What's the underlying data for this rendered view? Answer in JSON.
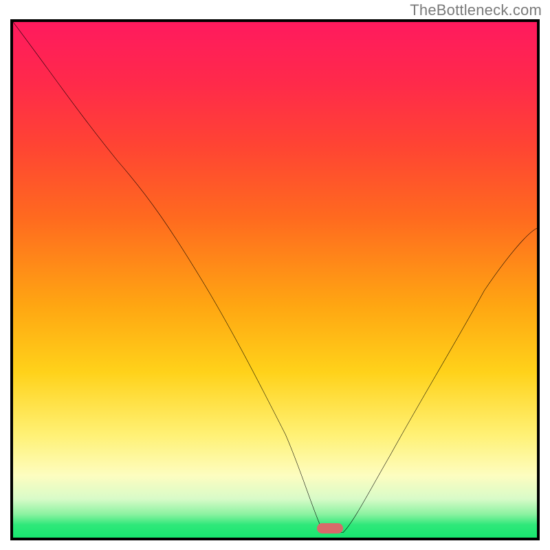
{
  "watermark": "TheBottleneck.com",
  "colors": {
    "frame_border": "#000000",
    "curve_stroke": "#000000",
    "marker_fill": "#d86a6a",
    "gradient_top": "#ff1a5e",
    "gradient_bottom": "#18e66f"
  },
  "chart_data": {
    "type": "line",
    "title": "",
    "xlabel": "",
    "ylabel": "",
    "xlim": [
      0,
      100
    ],
    "ylim": [
      0,
      100
    ],
    "grid": false,
    "legend": false,
    "background": "vertical-gradient-red-to-green",
    "series": [
      {
        "name": "bottleneck-curve",
        "x": [
          0,
          10,
          20,
          28,
          36,
          44,
          52,
          58,
          60,
          62,
          64,
          68,
          76,
          88,
          100
        ],
        "values": [
          100,
          87,
          73,
          64,
          50,
          36,
          20,
          4,
          1,
          1,
          2,
          8,
          22,
          42,
          60
        ]
      }
    ],
    "annotations": [
      {
        "name": "optimal-marker",
        "x": 61,
        "y": 1,
        "shape": "rounded-pill",
        "color": "#d86a6a"
      }
    ]
  }
}
